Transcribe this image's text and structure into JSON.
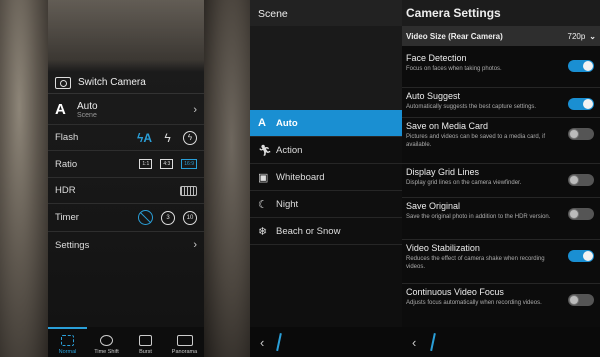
{
  "camera_menu": {
    "switch_camera": "Switch Camera",
    "scene": {
      "value": "Auto",
      "label": "Scene",
      "letter": "A"
    },
    "flash": {
      "label": "Flash",
      "selected": "auto"
    },
    "ratio": {
      "label": "Ratio",
      "options": [
        "1:1",
        "4:3",
        "16:9"
      ],
      "selected": "16:9"
    },
    "hdr": {
      "label": "HDR"
    },
    "timer": {
      "label": "Timer",
      "options": [
        "3",
        "10"
      ],
      "selected": "off"
    },
    "settings": {
      "label": "Settings"
    },
    "modes": [
      {
        "label": "Normal",
        "active": true
      },
      {
        "label": "Time Shift",
        "active": false
      },
      {
        "label": "Burst",
        "active": false
      },
      {
        "label": "Panorama",
        "active": false
      }
    ]
  },
  "scene_panel": {
    "title": "Scene",
    "items": [
      {
        "label": "Auto",
        "icon": "A",
        "active": true
      },
      {
        "label": "Action",
        "icon": "action-icon",
        "active": false
      },
      {
        "label": "Whiteboard",
        "icon": "whiteboard-icon",
        "active": false
      },
      {
        "label": "Night",
        "icon": "moon-icon",
        "active": false
      },
      {
        "label": "Beach or Snow",
        "icon": "beach-snow-icon",
        "active": false
      }
    ]
  },
  "settings_panel": {
    "title": "Camera Settings",
    "video_size": {
      "label": "Video Size (Rear Camera)",
      "value": "720p"
    },
    "items": [
      {
        "title": "Face Detection",
        "desc": "Focus on faces when taking photos.",
        "on": true
      },
      {
        "title": "Auto Suggest",
        "desc": "Automatically suggests the best capture settings.",
        "on": true
      },
      {
        "title": "Save on Media Card",
        "desc": "Pictures and videos can be saved to a media card, if available.",
        "on": false
      },
      {
        "title": "Display Grid Lines",
        "desc": "Display grid lines on the camera viewfinder.",
        "on": false
      },
      {
        "title": "Save Original",
        "desc": "Save the original photo in addition to the HDR version.",
        "on": false
      },
      {
        "title": "Video Stabilization",
        "desc": "Reduces the effect of camera shake when recording videos.",
        "on": true
      },
      {
        "title": "Continuous Video Focus",
        "desc": "Adjusts focus automatically when recording videos.",
        "on": false
      }
    ]
  },
  "colors": {
    "accent": "#1a8fd2",
    "panel": "#0f0f0f"
  }
}
